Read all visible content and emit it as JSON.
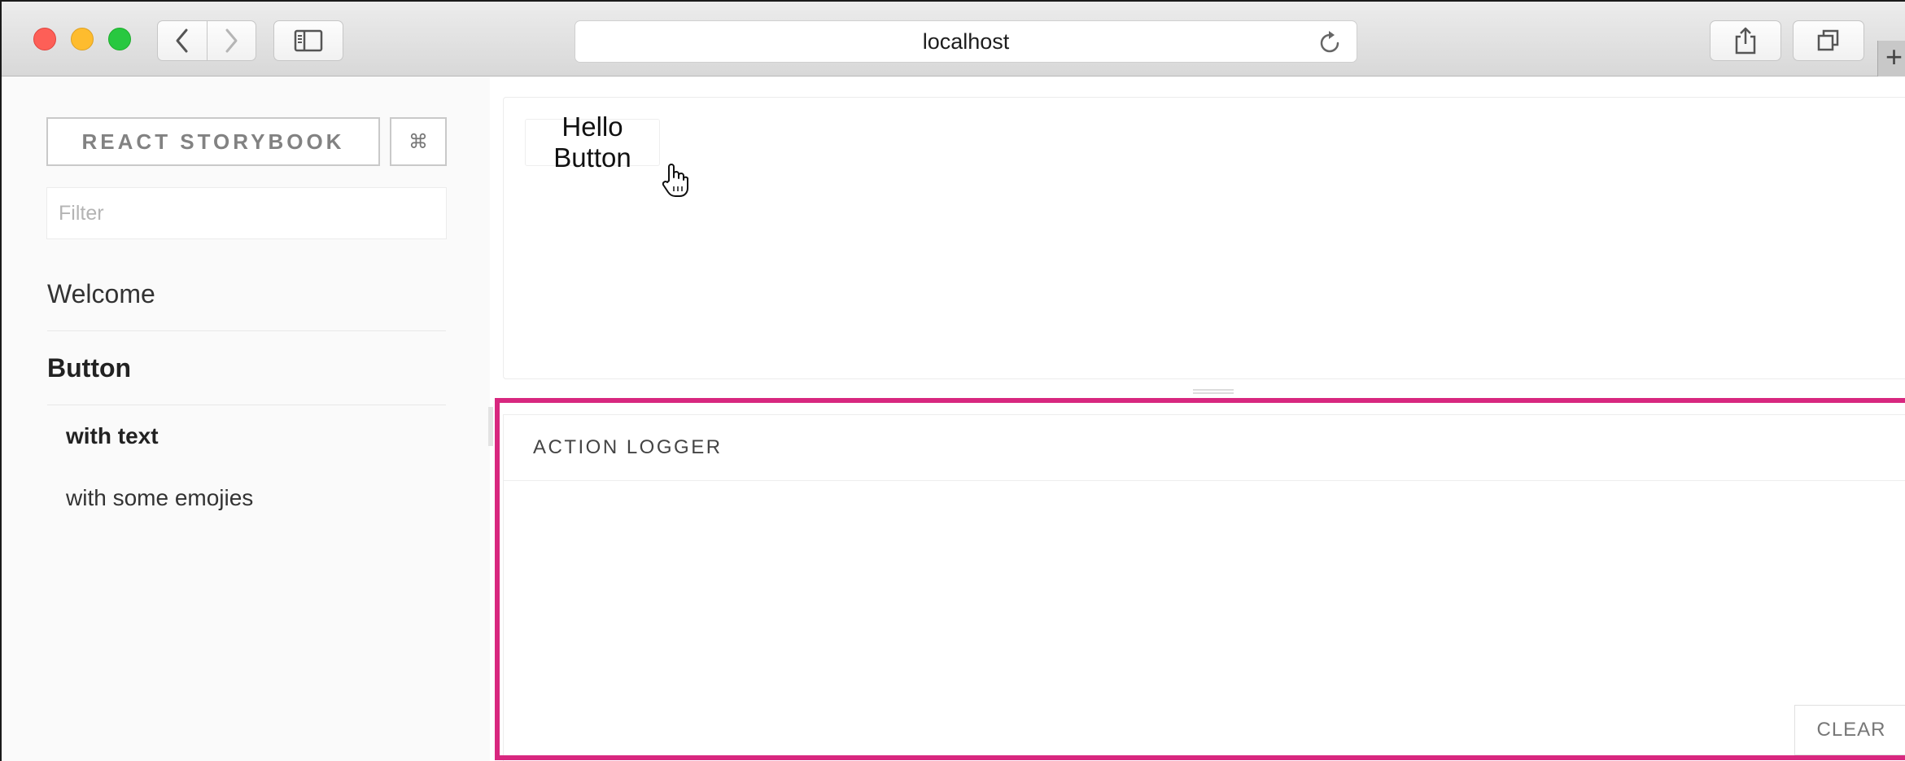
{
  "browser": {
    "url": "localhost",
    "tab_new_label": "+"
  },
  "sidebar": {
    "brand_label": "REACT STORYBOOK",
    "shortcut_label": "⌘",
    "filter_placeholder": "Filter",
    "kinds": [
      {
        "label": "Welcome",
        "selected": false
      },
      {
        "label": "Button",
        "selected": true
      }
    ],
    "stories": [
      {
        "label": "with text",
        "selected": true
      },
      {
        "label": "with some emojies",
        "selected": false
      }
    ]
  },
  "preview": {
    "button_label": "Hello Button"
  },
  "action_logger": {
    "title": "ACTION LOGGER",
    "clear_label": "CLEAR",
    "highlight_color": "#d8277f"
  }
}
